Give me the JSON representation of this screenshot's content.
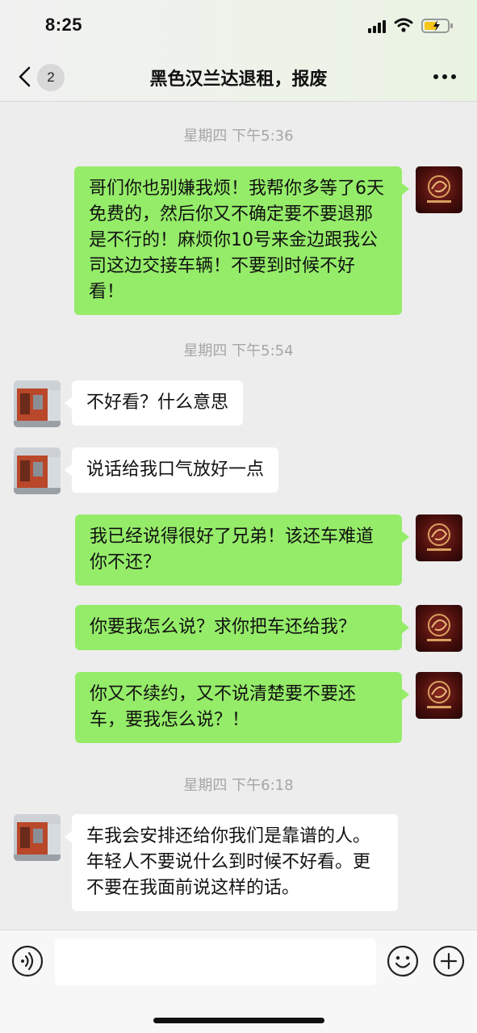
{
  "status_bar": {
    "time": "8:25"
  },
  "header": {
    "unread_count": "2",
    "title": "黑色汉兰达退租，报废"
  },
  "messages": [
    {
      "type": "timestamp",
      "text": "星期四 下午5:36"
    },
    {
      "type": "bubble",
      "side": "me",
      "text": "哥们你也别嫌我烦！我帮你多等了6天免费的，然后你又不确定要不要退那是不行的！麻烦你10号来金边跟我公司这边交接车辆！不要到时候不好看！"
    },
    {
      "type": "timestamp",
      "text": "星期四 下午5:54"
    },
    {
      "type": "bubble",
      "side": "other",
      "text": "不好看？什么意思"
    },
    {
      "type": "bubble",
      "side": "other",
      "text": "说话给我口气放好一点"
    },
    {
      "type": "bubble",
      "side": "me",
      "text": "我已经说得很好了兄弟！该还车难道你不还？"
    },
    {
      "type": "bubble",
      "side": "me",
      "text": "你要我怎么说？求你把车还给我？"
    },
    {
      "type": "bubble",
      "side": "me",
      "text": "你又不续约，又不说清楚要不要还车，要我怎么说？！"
    },
    {
      "type": "timestamp",
      "text": "星期四 下午6:18"
    },
    {
      "type": "bubble",
      "side": "other",
      "text": "车我会安排还给你我们是靠谱的人。年轻人不要说什么到时候不好看。更不要在我面前说这样的话。"
    }
  ],
  "colors": {
    "bubble_me": "#95ec69",
    "bubble_other": "#ffffff",
    "background": "#ededed"
  },
  "icons": [
    "signal-icon",
    "wifi-icon",
    "battery-icon",
    "back-icon",
    "more-icon",
    "voice-icon",
    "emoji-icon",
    "plus-icon"
  ]
}
